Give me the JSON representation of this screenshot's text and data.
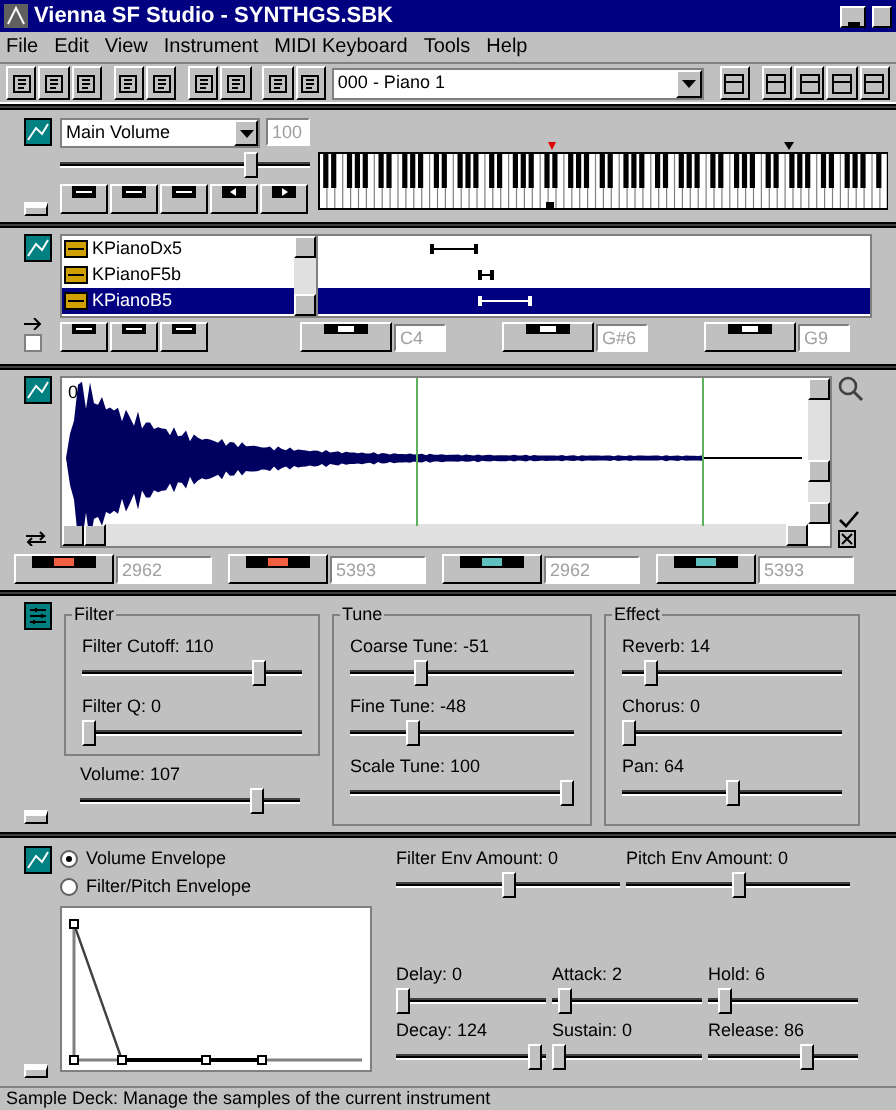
{
  "window": {
    "title": "Vienna SF Studio - SYNTHGS.SBK"
  },
  "menu": [
    "File",
    "Edit",
    "View",
    "Instrument",
    "MIDI Keyboard",
    "Tools",
    "Help"
  ],
  "toolbar": {
    "preset": "000 - Piano 1"
  },
  "keyboard_panel": {
    "controller": "Main Volume",
    "value": "100",
    "slider": {
      "level": 0.78
    }
  },
  "splits": {
    "items": [
      {
        "label": "KPianoDx5",
        "selected": false
      },
      {
        "label": "KPianoF5b",
        "selected": false
      },
      {
        "label": "KPianoB5",
        "selected": true
      }
    ],
    "key_fields": [
      "C4",
      "G#6",
      "G9"
    ],
    "checkbox": {
      "checked": false
    }
  },
  "sample": {
    "start_label": "0",
    "loop_fields": [
      "2962",
      "5393",
      "2962",
      "5393"
    ]
  },
  "params": {
    "filter": {
      "title": "Filter",
      "sliders": [
        {
          "label": "Filter Cutoff: 110",
          "level": 0.83
        },
        {
          "label": "Filter Q: 0",
          "level": 0
        }
      ]
    },
    "volume": {
      "label": "Volume: 107",
      "level": 0.83
    },
    "tune": {
      "title": "Tune",
      "sliders": [
        {
          "label": "Coarse Tune: -51",
          "level": 0.3
        },
        {
          "label": "Fine Tune: -48",
          "level": 0.27
        },
        {
          "label": "Scale Tune: 100",
          "level": 1
        }
      ]
    },
    "effect": {
      "title": "Effect",
      "sliders": [
        {
          "label": "Reverb: 14",
          "level": 0.11
        },
        {
          "label": "Chorus: 0",
          "level": 0
        },
        {
          "label": "Pan: 64",
          "level": 0.5
        }
      ]
    }
  },
  "envelope": {
    "modes": [
      {
        "label": "Volume Envelope",
        "selected": true
      },
      {
        "label": "Filter/Pitch Envelope",
        "selected": false
      }
    ],
    "amounts": [
      {
        "label": "Filter Env Amount: 0",
        "level": 0.5
      },
      {
        "label": "Pitch Env Amount: 0",
        "level": 0.5
      }
    ],
    "stages": [
      {
        "label": "Delay: 0",
        "level": 0
      },
      {
        "label": "Attack: 2",
        "level": 0.04
      },
      {
        "label": "Hold: 6",
        "level": 0.07
      },
      {
        "label": "Decay: 124",
        "level": 0.97
      },
      {
        "label": "Sustain: 0",
        "level": 0
      },
      {
        "label": "Release: 86",
        "level": 0.67
      }
    ]
  },
  "status_bar": "Sample Deck: Manage the samples of the current instrument"
}
